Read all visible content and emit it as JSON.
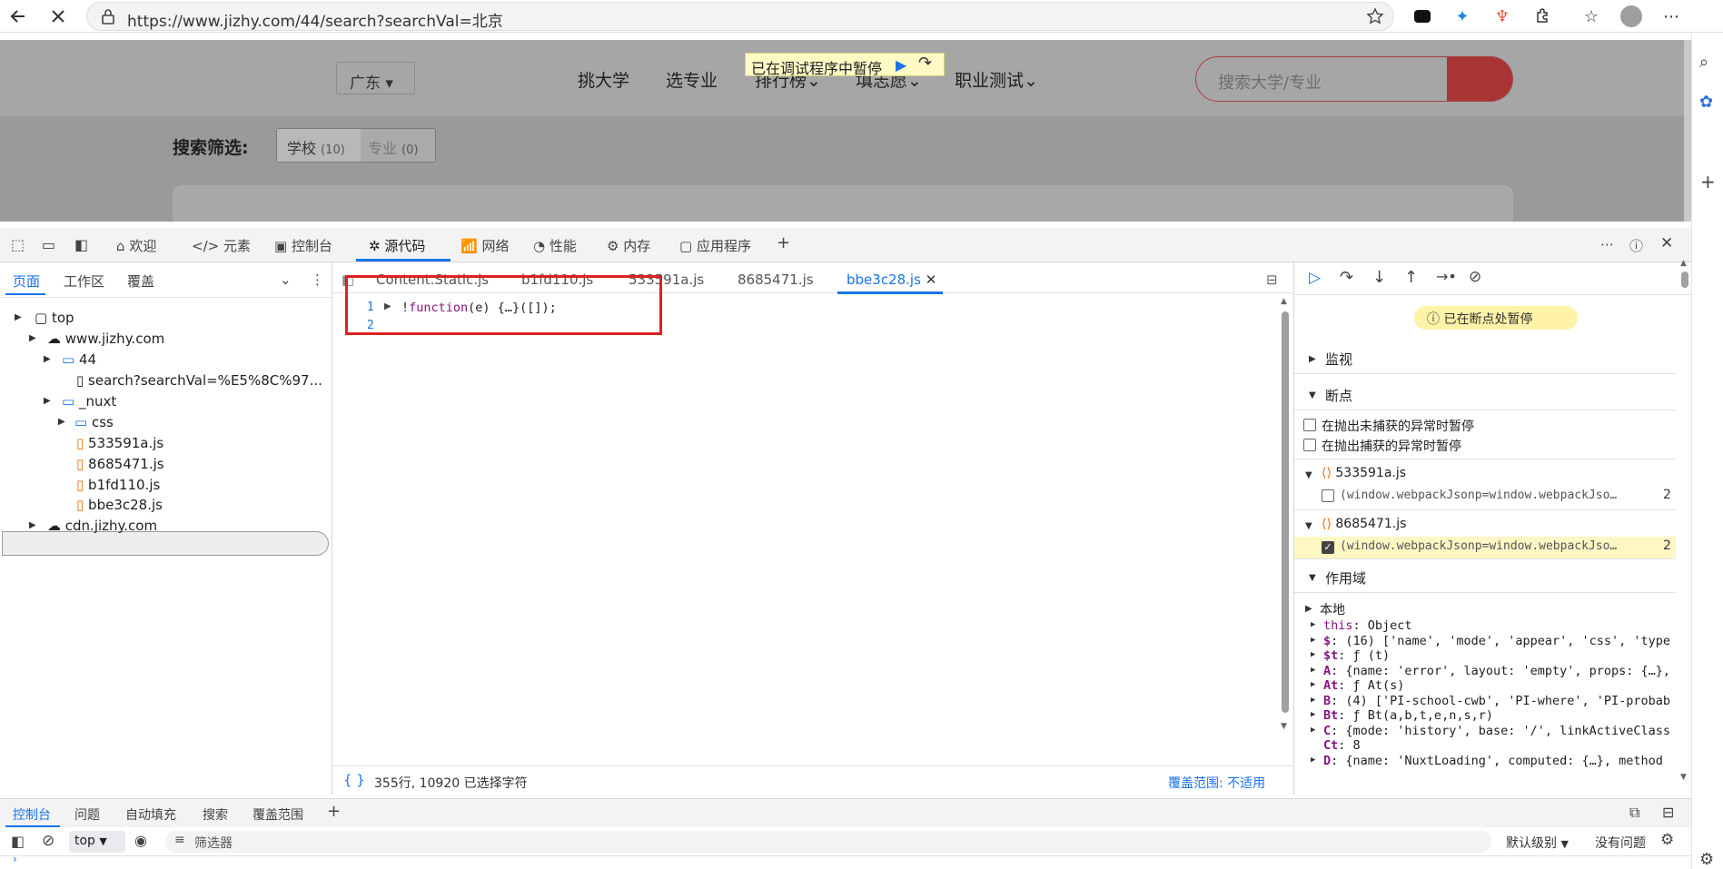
{
  "browser": {
    "url": "https://www.jizhy.com/44/search?searchVal=北京"
  },
  "page": {
    "province": "广东",
    "nav": [
      "挑大学",
      "选专业",
      "排行榜",
      "填志愿",
      "职业测试"
    ],
    "debug_banner": "已在调试程序中暂停",
    "search_placeholder": "搜索大学/专业",
    "filter_label": "搜索筛选:",
    "filter_school": "学校",
    "filter_school_count": "(10)",
    "filter_major": "专业",
    "filter_major_count": "(0)"
  },
  "devtools": {
    "tabs": [
      "欢迎",
      "元素",
      "控制台",
      "源代码",
      "网络",
      "性能",
      "内存",
      "应用程序"
    ],
    "active_tab": "源代码",
    "navigator_tabs": [
      "页面",
      "工作区",
      "覆盖"
    ],
    "tree": {
      "top": "top",
      "domain": "www.jizhy.com",
      "folder_44": "44",
      "search_file": "search?searchVal=%E5%8C%97...",
      "nuxt": "_nuxt",
      "css": "css",
      "f1": "533591a.js",
      "f2": "8685471.js",
      "f3": "b1fd110.js",
      "f4": "bbe3c28.js",
      "cdn": "cdn.jizhy.com"
    },
    "file_tabs": [
      "Content.Static.js",
      "b1fd110.js",
      "533591a.js",
      "8685471.js",
      "bbe3c28.js"
    ],
    "code": {
      "ln1": "1",
      "ln2": "2",
      "line1_bang": "!",
      "line1_kw": "function",
      "line1_rest": "(e) {…}([]);"
    },
    "status_left": "355行, 10920 已选择字符",
    "status_right": "覆盖范围: 不适用",
    "paused_badge": "已在断点处暂停",
    "watch": "监视",
    "breakpoints": "断点",
    "pause_uncaught": "在抛出未捕获的异常时暂停",
    "pause_caught": "在抛出捕获的异常时暂停",
    "bp_file1": "533591a.js",
    "bp_code1": "(window.webpackJsonp=window.webpackJso…",
    "bp_line1": "2",
    "bp_file2": "8685471.js",
    "bp_code2": "(window.webpackJsonp=window.webpackJso…",
    "bp_line2": "2",
    "scope": "作用域",
    "local": "本地",
    "scope_rows": [
      {
        "k": "this",
        "v": "Object"
      },
      {
        "k": "$",
        "v": "(16) ['name', 'mode', 'appear', 'css', 'type"
      },
      {
        "k": "$t",
        "v": "ƒ (t)"
      },
      {
        "k": "A",
        "v": "{name: 'error', layout: 'empty', props: {…},"
      },
      {
        "k": "At",
        "v": "ƒ At(s)"
      },
      {
        "k": "B",
        "v": "(4) ['PI-school-cwb', 'PI-where', 'PI-probab"
      },
      {
        "k": "Bt",
        "v": "ƒ Bt(a,b,t,e,n,s,r)"
      },
      {
        "k": "C",
        "v": "{mode: 'history', base: '/', linkActiveClass"
      },
      {
        "k": "Ct",
        "v": "8"
      },
      {
        "k": "D",
        "v": "{name: 'NuxtLoading', computed: {…}, method"
      }
    ]
  },
  "drawer": {
    "tabs": [
      "控制台",
      "问题",
      "自动填充",
      "搜索",
      "覆盖范围"
    ],
    "context": "top",
    "filter_placeholder": "筛选器",
    "level": "默认级别",
    "issues": "没有问题"
  },
  "colors": {
    "accent": "#1a73e8",
    "highlight_red": "#e02020",
    "breakpoint_yellow": "#fef7c4"
  }
}
